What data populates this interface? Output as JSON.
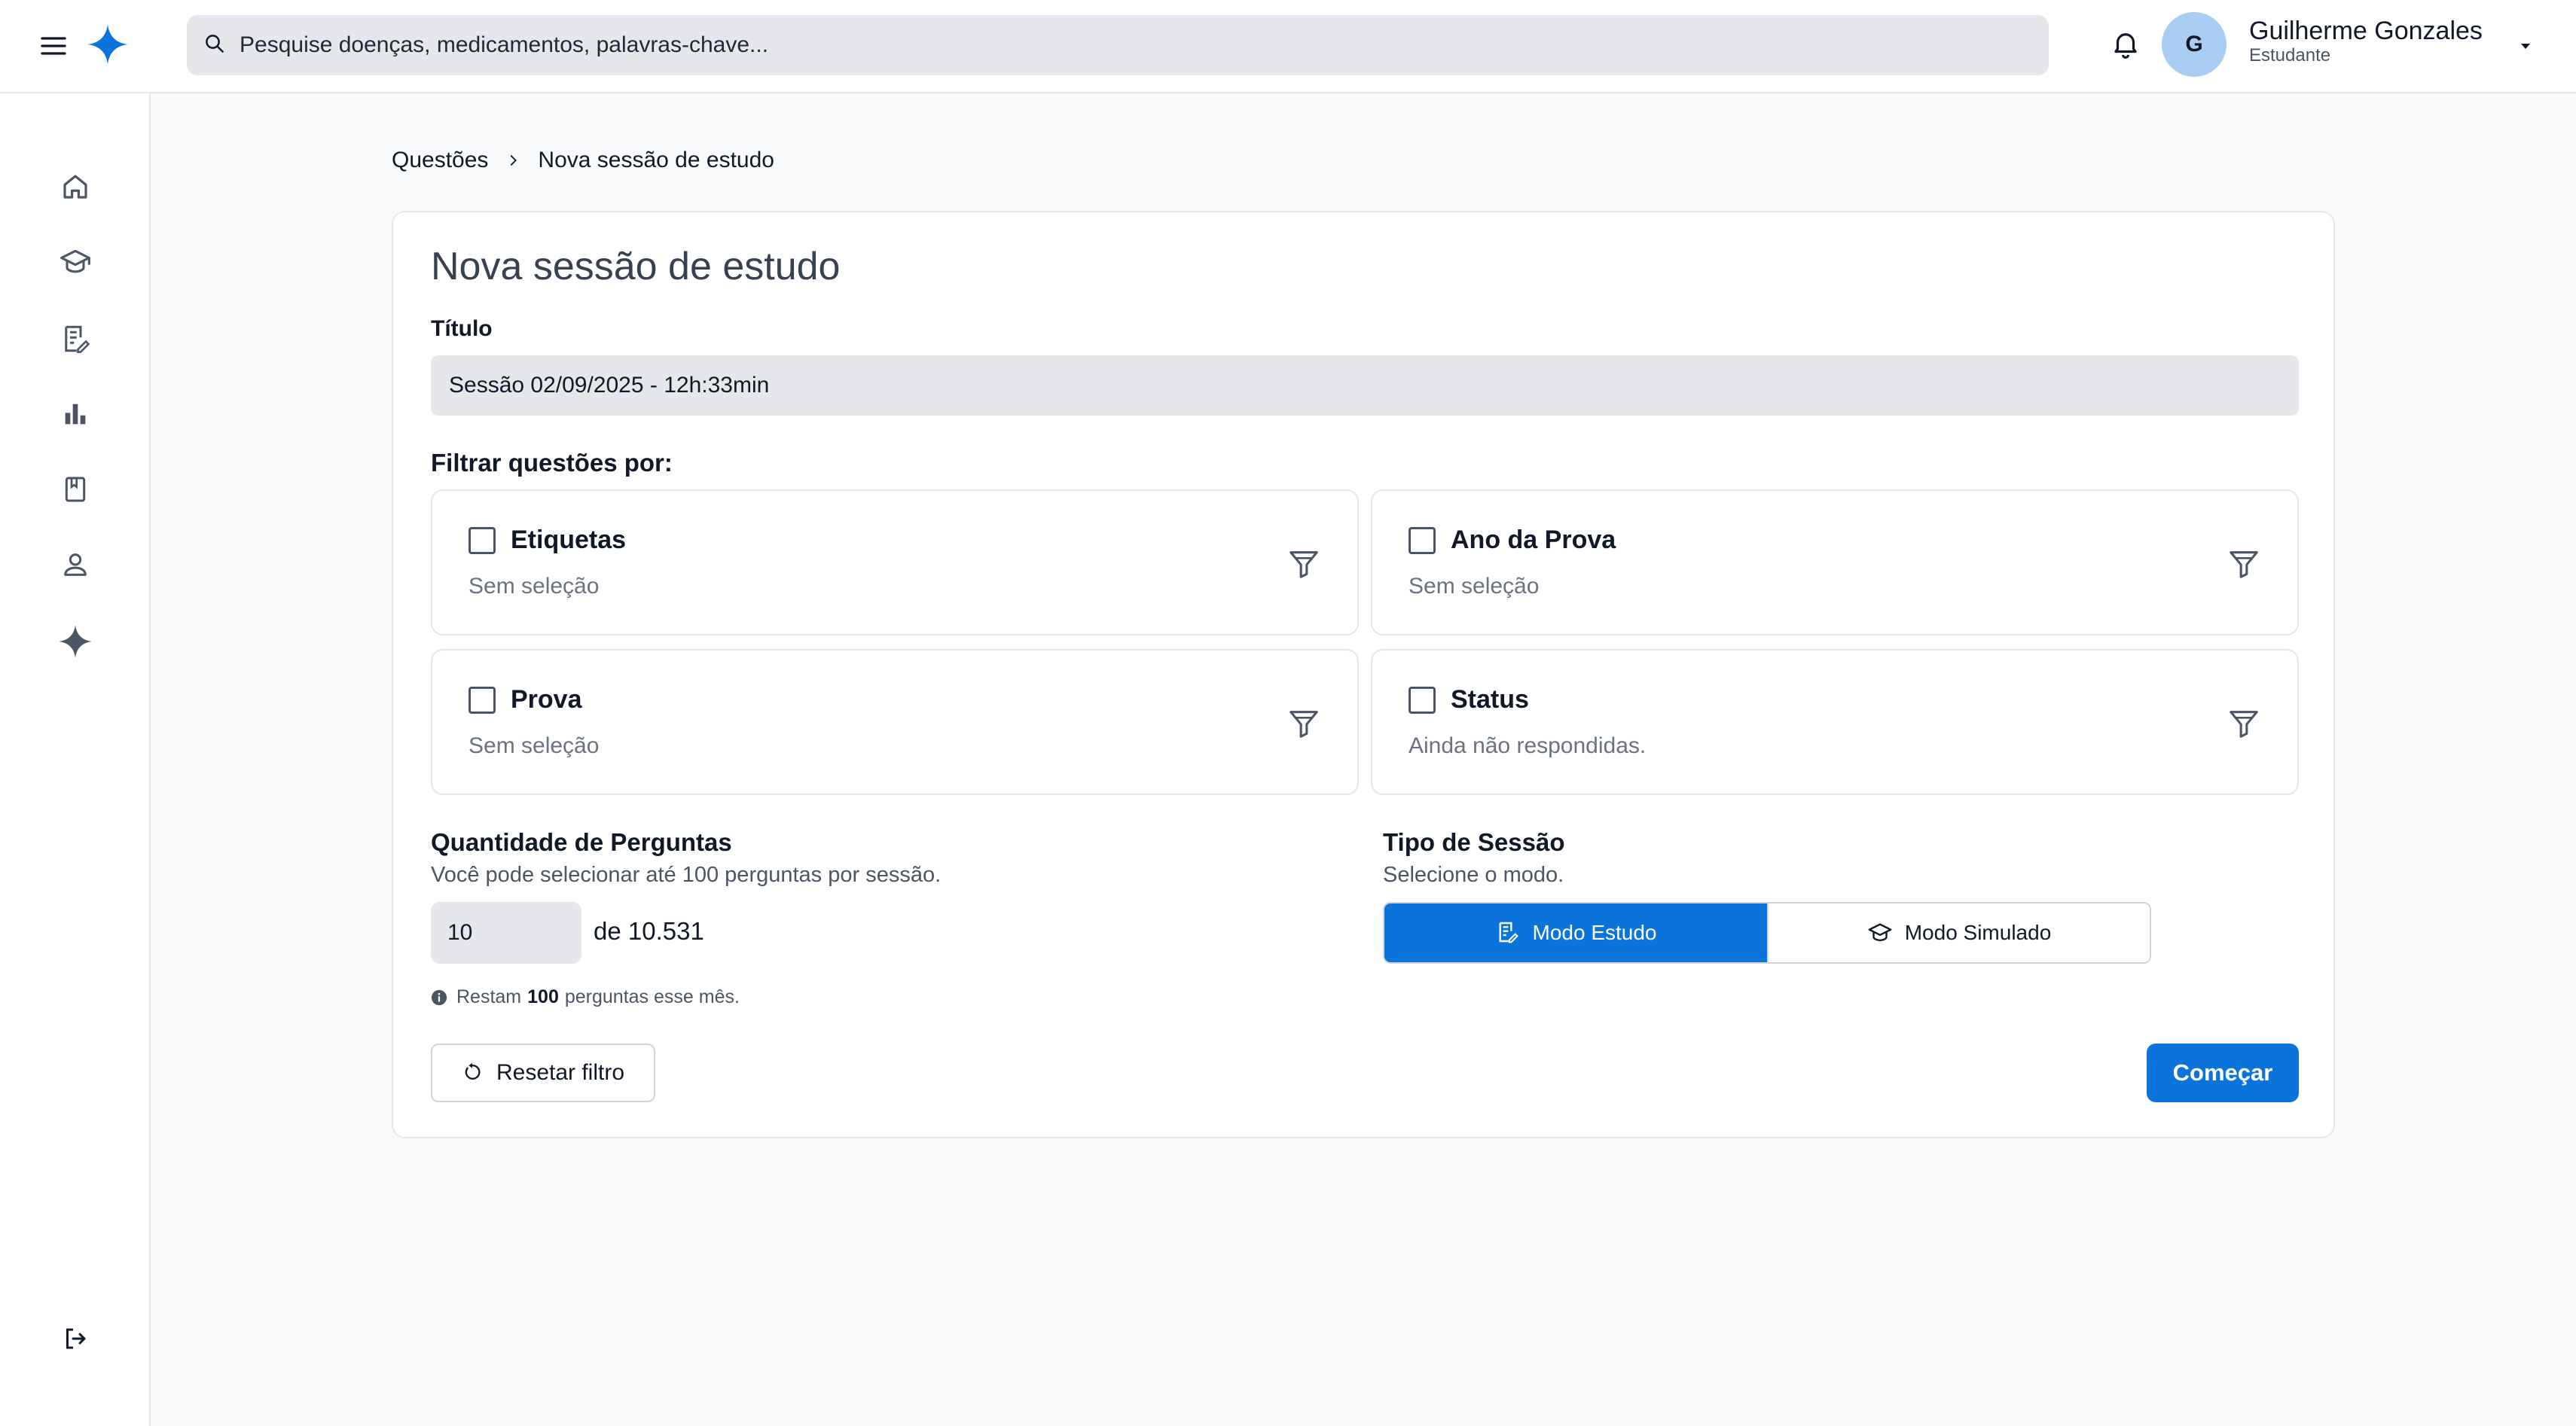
{
  "header": {
    "search_placeholder": "Pesquise doenças, medicamentos, palavras-chave...",
    "user": {
      "initial": "G",
      "name": "Guilherme Gonzales",
      "role": "Estudante"
    }
  },
  "sidebar": {
    "items": [
      {
        "icon": "home-icon"
      },
      {
        "icon": "graduation-cap-icon"
      },
      {
        "icon": "questions-icon"
      },
      {
        "icon": "bar-chart-icon"
      },
      {
        "icon": "bookmark-book-icon"
      },
      {
        "icon": "user-icon"
      },
      {
        "icon": "sparkle-icon"
      }
    ],
    "bottom_icon": "logout-icon"
  },
  "breadcrumb": {
    "parent": "Questões",
    "current": "Nova sessão de estudo"
  },
  "form": {
    "heading": "Nova sessão de estudo",
    "title_label": "Título",
    "title_value": "Sessão 02/09/2025 - 12h:33min",
    "filter_label": "Filtrar questões por:",
    "filters": [
      {
        "name": "Etiquetas",
        "value": "Sem seleção",
        "checked": false
      },
      {
        "name": "Ano da Prova",
        "value": "Sem seleção",
        "checked": false
      },
      {
        "name": "Prova",
        "value": "Sem seleção",
        "checked": false
      },
      {
        "name": "Status",
        "value": "Ainda não respondidas.",
        "checked": false
      }
    ],
    "quantity": {
      "label": "Quantidade de Perguntas",
      "help": "Você pode selecionar até 100 perguntas por sessão.",
      "value": "10",
      "total": "de 10.531",
      "remaining_prefix": "Restam",
      "remaining_count": "100",
      "remaining_suffix": "perguntas esse mês."
    },
    "session_type": {
      "label": "Tipo de Sessão",
      "help": "Selecione o modo.",
      "options": [
        {
          "label": "Modo Estudo",
          "active": true
        },
        {
          "label": "Modo Simulado",
          "active": false
        }
      ]
    },
    "reset_label": "Resetar filtro",
    "start_label": "Começar"
  },
  "colors": {
    "primary": "#0a74da",
    "avatar_bg": "#a9cdf3",
    "input_bg": "#e5e7eb"
  }
}
